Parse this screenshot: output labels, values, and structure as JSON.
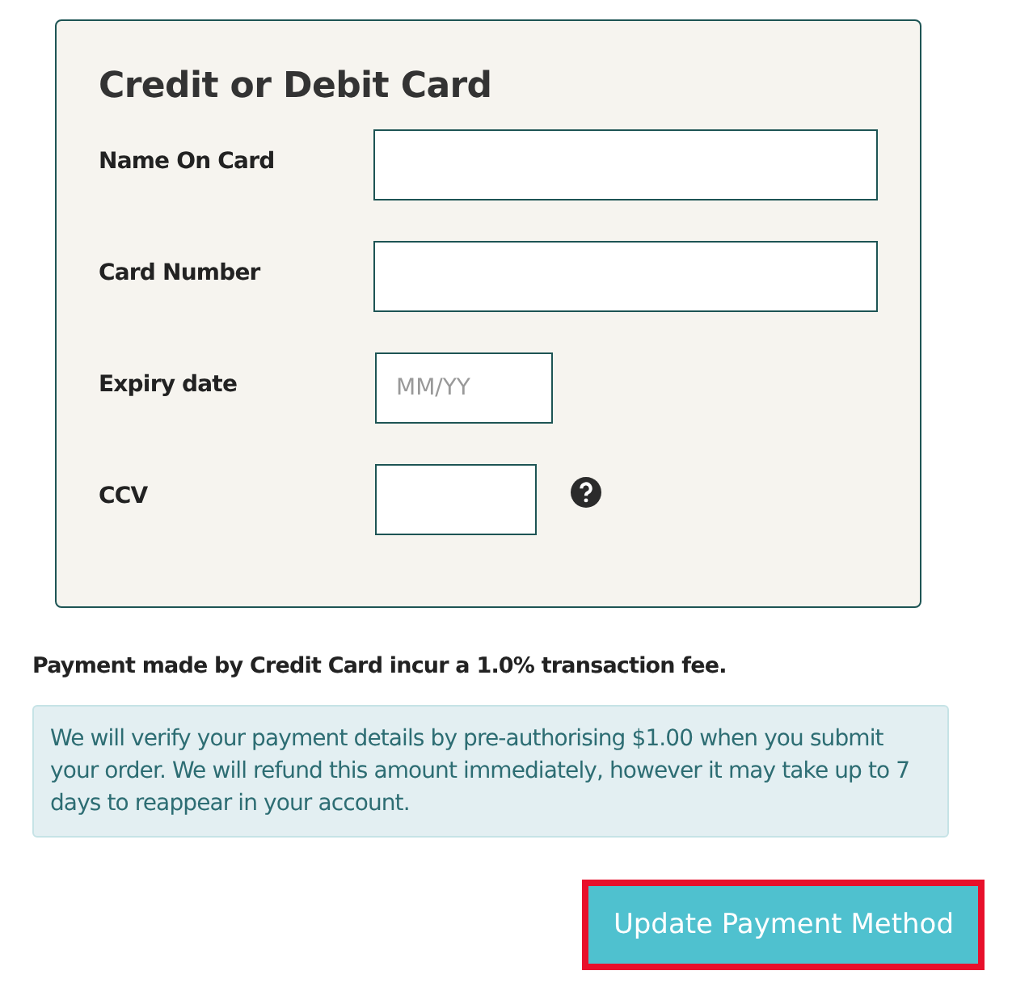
{
  "card_form": {
    "title": "Credit or Debit Card",
    "fields": [
      {
        "label": "Name On Card",
        "kind": "wide",
        "help": false
      },
      {
        "label": "Card Number",
        "kind": "wide",
        "help": false
      },
      {
        "label": "Expiry date",
        "kind": "date",
        "placeholder": "MM/YY",
        "help": false
      },
      {
        "label": "CCV",
        "kind": "code",
        "help": true
      }
    ]
  },
  "fee_note": "Payment made by Credit Card incur a 1.0% transaction fee.",
  "info_box": "We will verify your payment details by pre-authorising $1.00 when you submit your order. We will refund this amount immediately, however it may take up to 7 days to reappear in your account.",
  "submit_button": {
    "label": "Update Payment Method",
    "highlighted": true
  }
}
